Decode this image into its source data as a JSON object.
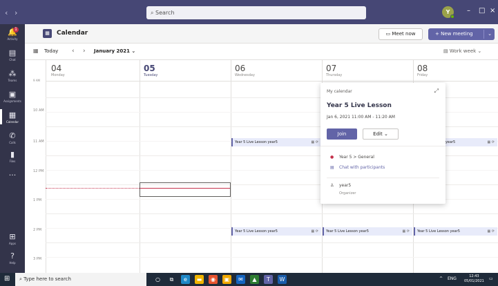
{
  "titlebar": {
    "back_icon": "back-arrow-icon",
    "forward_icon": "forward-arrow-icon",
    "search_placeholder": "Search",
    "avatar_initial": "Y",
    "minimize": "–",
    "maximize": "□",
    "close": "×"
  },
  "rail": {
    "items": [
      {
        "label": "Activity",
        "icon": "bell-icon",
        "badge": "1"
      },
      {
        "label": "Chat",
        "icon": "chat-icon"
      },
      {
        "label": "Teams",
        "icon": "teams-icon"
      },
      {
        "label": "Assignments",
        "icon": "assignments-icon"
      },
      {
        "label": "Calendar",
        "icon": "calendar-icon"
      },
      {
        "label": "Calls",
        "icon": "phone-icon"
      },
      {
        "label": "Files",
        "icon": "file-icon"
      },
      {
        "label": "...",
        "icon": "more-icon"
      },
      {
        "label": "Apps",
        "icon": "apps-icon"
      },
      {
        "label": "Help",
        "icon": "help-icon"
      }
    ]
  },
  "header": {
    "title": "Calendar",
    "meet_now": "Meet now",
    "new_meeting": "+ New meeting"
  },
  "toolbar": {
    "today": "Today",
    "month": "January 2021",
    "view": "Work week"
  },
  "days": [
    {
      "num": "04",
      "name": "Monday"
    },
    {
      "num": "05",
      "name": "Tuesday"
    },
    {
      "num": "06",
      "name": "Wednesday"
    },
    {
      "num": "07",
      "name": "Thursday"
    },
    {
      "num": "08",
      "name": "Friday"
    }
  ],
  "times": [
    "9 AM",
    "10 AM",
    "11 AM",
    "12 PM",
    "1 PM",
    "2 PM",
    "3 PM"
  ],
  "events": {
    "wed_11": "Year 5 Live Lesson  year5",
    "fri_11": "on  year5",
    "wed_2": "Year 5 Live Lesson  year5",
    "thu_2": "Year 5 Live Lesson  year5",
    "fri_2": "Year 5 Live Lesson  year5"
  },
  "popup": {
    "calendar": "My calendar",
    "title": "Year 5 Live Lesson",
    "time": "Jan 6, 2021 11:00 AM - 11:20 AM",
    "join": "Join",
    "edit": "Edit",
    "channel": "Year 5 > General",
    "chat": "Chat with participants",
    "organizer_name": "year5",
    "organizer_role": "Organizer"
  },
  "taskbar": {
    "search_placeholder": "Type here to search",
    "lang": "ENG",
    "time": "12:43",
    "date": "05/01/2021"
  },
  "colors": {
    "brand": "#464775",
    "accent": "#6264a7",
    "rail": "#33344a",
    "now_line": "#c4314b"
  }
}
